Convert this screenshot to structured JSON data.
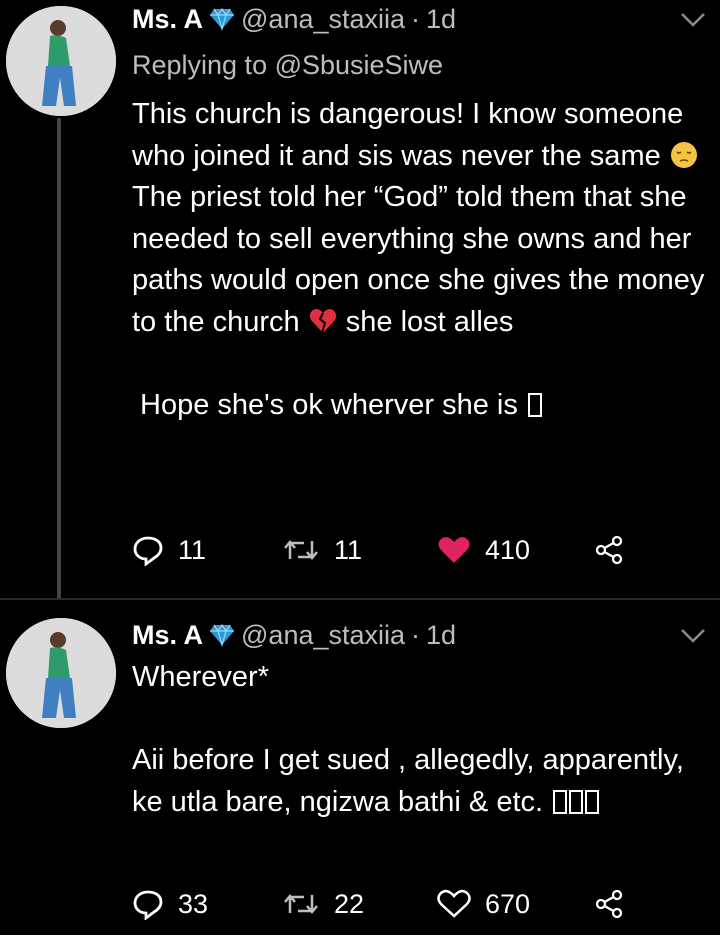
{
  "tweets": [
    {
      "display_name": "Ms. A",
      "handle": "@ana_staxiia",
      "separator": "·",
      "time": "1d",
      "replying_label": "Replying to @SbusieSiwe",
      "body": {
        "line1": "This church is dangerous! I know someone who joined it and sis was never the same",
        "line2": "The priest told her “God” told them that she needed to sell everything she owns and her paths would open once she gives the money to the church",
        "line2_tail": "she lost alles",
        "line3": "Hope she's ok wherver she is"
      },
      "stats": {
        "replies": "11",
        "retweets": "11",
        "likes": "410"
      },
      "liked": true
    },
    {
      "display_name": "Ms. A",
      "handle": "@ana_staxiia",
      "separator": "·",
      "time": "1d",
      "body": {
        "line1": "Wherever*",
        "line2": "Aii before I get sued , allegedly, apparently, ke utla bare, ngizwa bathi & etc."
      },
      "stats": {
        "replies": "33",
        "retweets": "22",
        "likes": "670"
      },
      "liked": false
    }
  ],
  "colors": {
    "background": "#000000",
    "text": "#ffffff",
    "muted": "#bdbdbd",
    "like": "#e0245e",
    "verified": "#1da1f2"
  },
  "icons": [
    "verified-diamond-icon",
    "chevron-down-icon",
    "reply-icon",
    "retweet-icon",
    "heart-icon",
    "share-icon",
    "pensive-face-emoji",
    "broken-heart-emoji"
  ]
}
